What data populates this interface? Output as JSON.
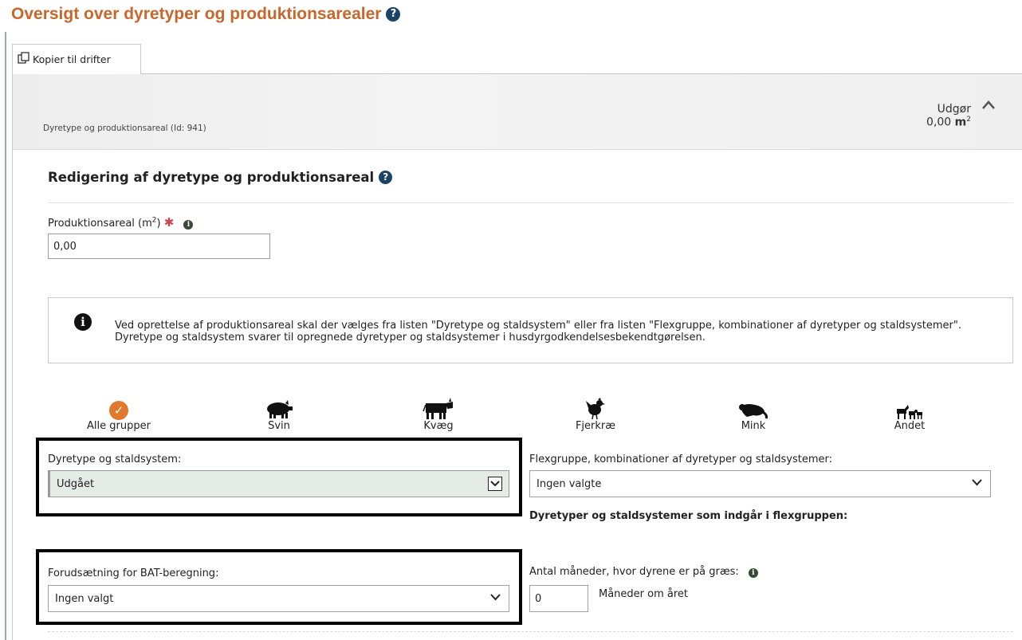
{
  "page": {
    "title": "Oversigt over dyretyper og produktionsarealer"
  },
  "tab": {
    "label": "Kopier til drifter"
  },
  "summary": {
    "id_text": "Dyretype og produktionsareal (Id: 941)",
    "usage_label": "Udgør",
    "usage_value": "0,00",
    "usage_unit": "m",
    "usage_unit_sup": "2"
  },
  "editor": {
    "title": "Redigering af dyretype og produktionsareal",
    "area_label": "Produktionsareal (m",
    "area_label_sup": "2",
    "area_label_end": ")",
    "area_value": "0,00",
    "notice_text": "Ved oprettelse af produktionsareal skal der vælges fra listen \"Dyretype og staldsystem\" eller fra listen \"Flexgruppe, kombinationer af dyretyper og staldsystemer\". Dyretype og staldsystem svarer til opregnede dyretyper og staldsystemer i husdyrgodkendelsesbekendtgørelsen."
  },
  "groups": [
    {
      "label": "Alle grupper",
      "icon": "check-circle-icon",
      "selected": true
    },
    {
      "label": "Svin",
      "icon": "pig-icon",
      "selected": false
    },
    {
      "label": "Kvæg",
      "icon": "cow-icon",
      "selected": false
    },
    {
      "label": "Fjerkræ",
      "icon": "chicken-icon",
      "selected": false
    },
    {
      "label": "Mink",
      "icon": "mink-icon",
      "selected": false
    },
    {
      "label": "Andet",
      "icon": "other-animals-icon",
      "selected": false
    }
  ],
  "fields": {
    "animal_type_label": "Dyretype og staldsystem:",
    "animal_type_value": "Udgået",
    "flex_label": "Flexgruppe, kombinationer af dyretyper og staldsystemer:",
    "flex_value": "Ingen valgte",
    "flex_included_label": "Dyretyper og staldsystemer som indgår i flexgruppen:",
    "bat_label": "Forudsætning for BAT-beregning:",
    "bat_value": "Ingen valgt",
    "grazing_label": "Antal måneder, hvor dyrene er på græs:",
    "grazing_value": "0",
    "grazing_unit": "Måneder om året"
  },
  "colors": {
    "title": "#c8672c",
    "help_icon": "#1b4366",
    "selected_group": "#e0792e",
    "required": "#d0434a",
    "gray_select": "#e5ebe5"
  }
}
